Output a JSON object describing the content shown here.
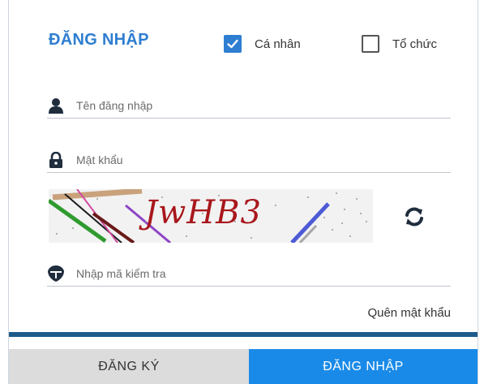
{
  "login": {
    "title": "ĐĂNG NHẬP",
    "account_types": [
      {
        "label": "Cá nhân",
        "checked": true
      },
      {
        "label": "Tổ chức",
        "checked": false
      }
    ],
    "username": {
      "placeholder": "Tên đăng nhập",
      "value": "",
      "icon": "user-icon"
    },
    "password": {
      "placeholder": "Mật khẩu",
      "value": "",
      "icon": "lock-icon"
    },
    "captcha": {
      "text": "JwHB3",
      "refresh_icon": "refresh-icon"
    },
    "captcha_input": {
      "placeholder": "Nhập mã kiểm tra",
      "value": "",
      "icon": "shield-icon"
    },
    "forgot_password": "Quên mật khẩu",
    "buttons": {
      "register": "ĐĂNG KÝ",
      "login": "ĐĂNG NHẬP"
    }
  },
  "colors": {
    "accent": "#2e7ed1",
    "login_button": "#1a8ae8",
    "register_button": "#dcdcdc",
    "captcha_text": "#a8171c",
    "divider_bar": "#1d5b8a"
  }
}
